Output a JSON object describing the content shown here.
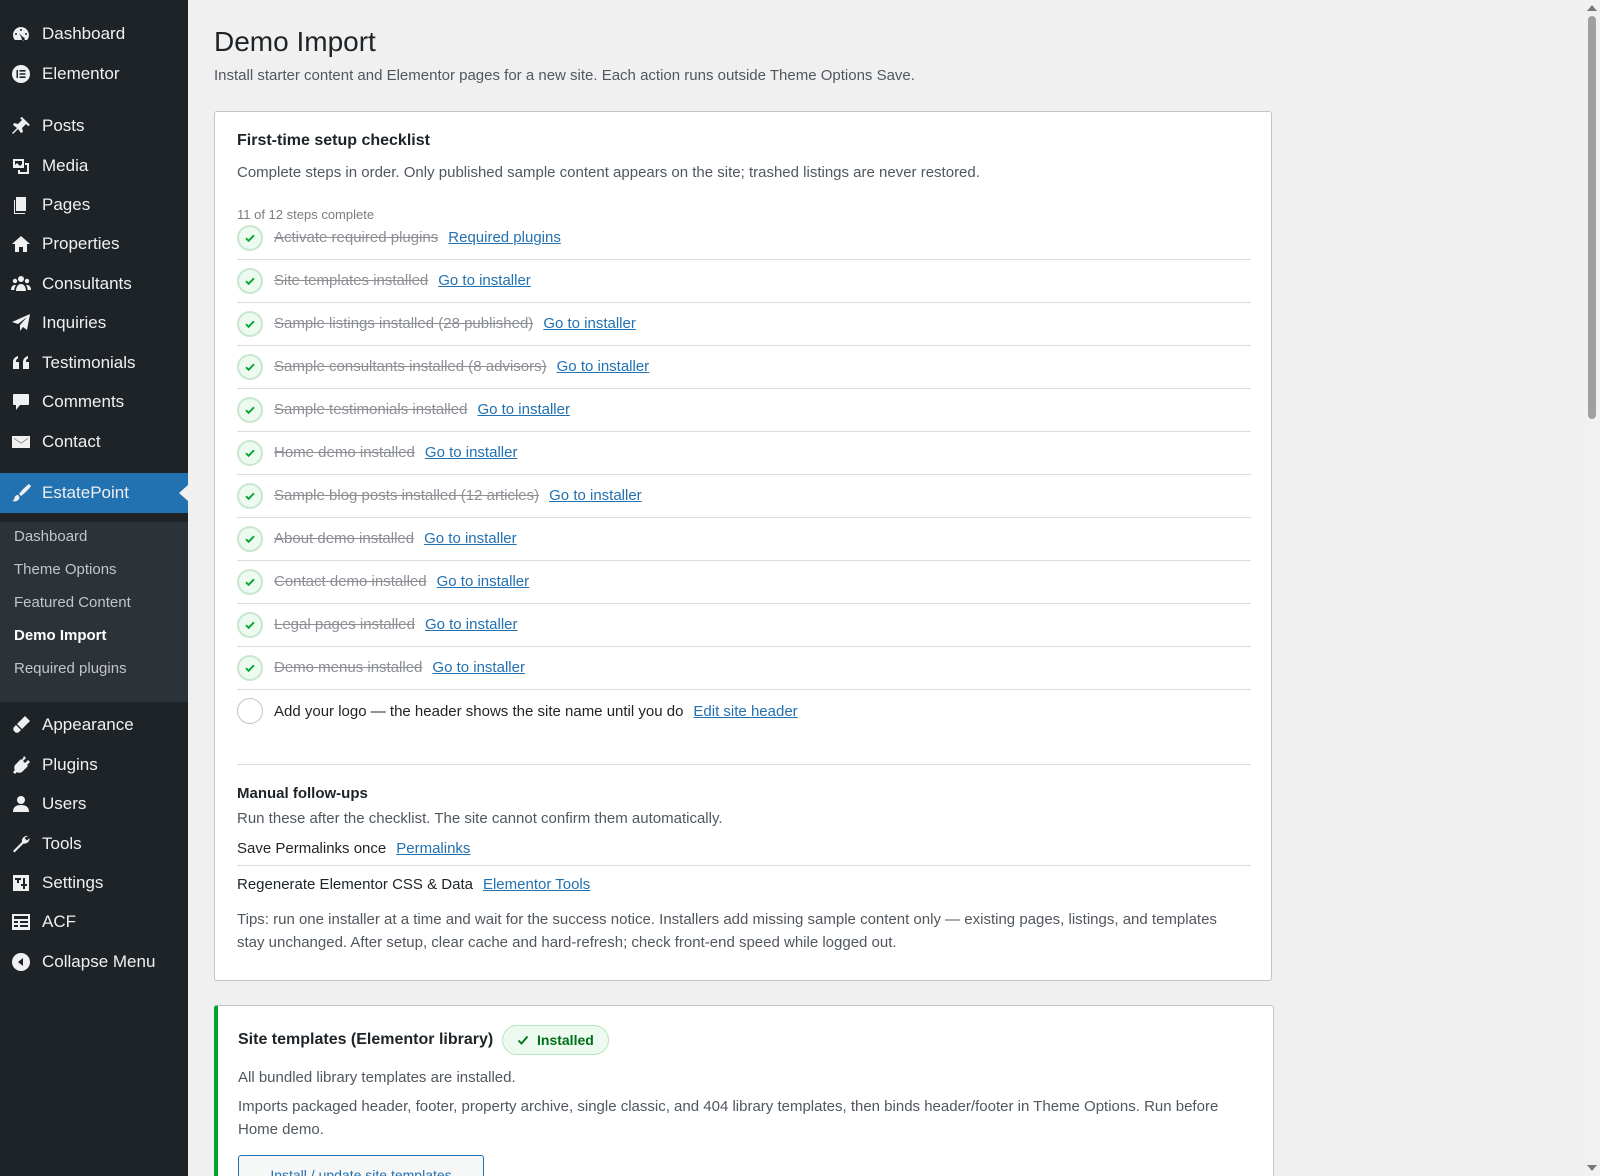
{
  "sidebar": {
    "items_top": [
      {
        "label": "Dashboard",
        "icon": "dashboard-icon"
      },
      {
        "label": "Elementor",
        "icon": "elementor-icon"
      },
      {
        "label": "Posts",
        "icon": "pin-icon"
      },
      {
        "label": "Media",
        "icon": "media-icon"
      },
      {
        "label": "Pages",
        "icon": "pages-icon"
      },
      {
        "label": "Properties",
        "icon": "home-icon"
      },
      {
        "label": "Consultants",
        "icon": "groups-icon"
      },
      {
        "label": "Inquiries",
        "icon": "send-icon"
      },
      {
        "label": "Testimonials",
        "icon": "quote-icon"
      },
      {
        "label": "Comments",
        "icon": "comment-icon"
      },
      {
        "label": "Contact",
        "icon": "email-icon"
      }
    ],
    "active": {
      "label": "EstatePoint",
      "icon": "brush-icon"
    },
    "submenu": [
      "Dashboard",
      "Theme Options",
      "Featured Content",
      "Demo Import",
      "Required plugins"
    ],
    "current_submenu": "Demo Import",
    "items_bottom": [
      {
        "label": "Appearance",
        "icon": "appearance-icon"
      },
      {
        "label": "Plugins",
        "icon": "plugins-icon"
      },
      {
        "label": "Users",
        "icon": "users-icon"
      },
      {
        "label": "Tools",
        "icon": "tools-icon"
      },
      {
        "label": "Settings",
        "icon": "settings-icon"
      },
      {
        "label": "ACF",
        "icon": "acf-icon"
      },
      {
        "label": "Collapse Menu",
        "icon": "collapse-icon"
      }
    ]
  },
  "page": {
    "title": "Demo Import",
    "subtitle": "Install starter content and Elementor pages for a new site. Each action runs outside Theme Options Save."
  },
  "checklist": {
    "title": "First-time setup checklist",
    "description": "Complete steps in order. Only published sample content appears on the site; trashed listings are never restored.",
    "progress": "11 of 12 steps complete",
    "steps": [
      {
        "label": "Activate required plugins",
        "link": "Required plugins",
        "done": true
      },
      {
        "label": "Site templates installed",
        "link": "Go to installer",
        "done": true
      },
      {
        "label": "Sample listings installed (28 published)",
        "link": "Go to installer",
        "done": true
      },
      {
        "label": "Sample consultants installed (8 advisors)",
        "link": "Go to installer",
        "done": true
      },
      {
        "label": "Sample testimonials installed",
        "link": "Go to installer",
        "done": true
      },
      {
        "label": "Home demo installed",
        "link": "Go to installer",
        "done": true
      },
      {
        "label": "Sample blog posts installed (12 articles)",
        "link": "Go to installer",
        "done": true
      },
      {
        "label": "About demo installed",
        "link": "Go to installer",
        "done": true
      },
      {
        "label": "Contact demo installed",
        "link": "Go to installer",
        "done": true
      },
      {
        "label": "Legal pages installed",
        "link": "Go to installer",
        "done": true
      },
      {
        "label": "Demo menus installed",
        "link": "Go to installer",
        "done": true
      },
      {
        "label": "Add your logo — the header shows the site name until you do",
        "link": "Edit site header",
        "done": false
      }
    ],
    "followups": {
      "title": "Manual follow-ups",
      "description": "Run these after the checklist. The site cannot confirm them automatically.",
      "items": [
        {
          "label": "Save Permalinks once",
          "link": "Permalinks"
        },
        {
          "label": "Regenerate Elementor CSS & Data",
          "link": "Elementor Tools"
        }
      ]
    },
    "tips": "Tips: run one installer at a time and wait for the success notice. Installers add missing sample content only — existing pages, listings, and templates stay unchanged. After setup, clear cache and hard-refresh; check front-end speed while logged out."
  },
  "site_templates": {
    "title": "Site templates (Elementor library)",
    "badge": "Installed",
    "status": "All bundled library templates are installed.",
    "description": "Imports packaged header, footer, property archive, single classic, and 404 library templates, then binds header/footer in Theme Options. Run before Home demo.",
    "button": "Install / update site templates"
  },
  "colors": {
    "sidebar_bg": "#1d2327",
    "active_bg": "#2271b1",
    "success": "#00a32a",
    "link": "#2271b1"
  }
}
